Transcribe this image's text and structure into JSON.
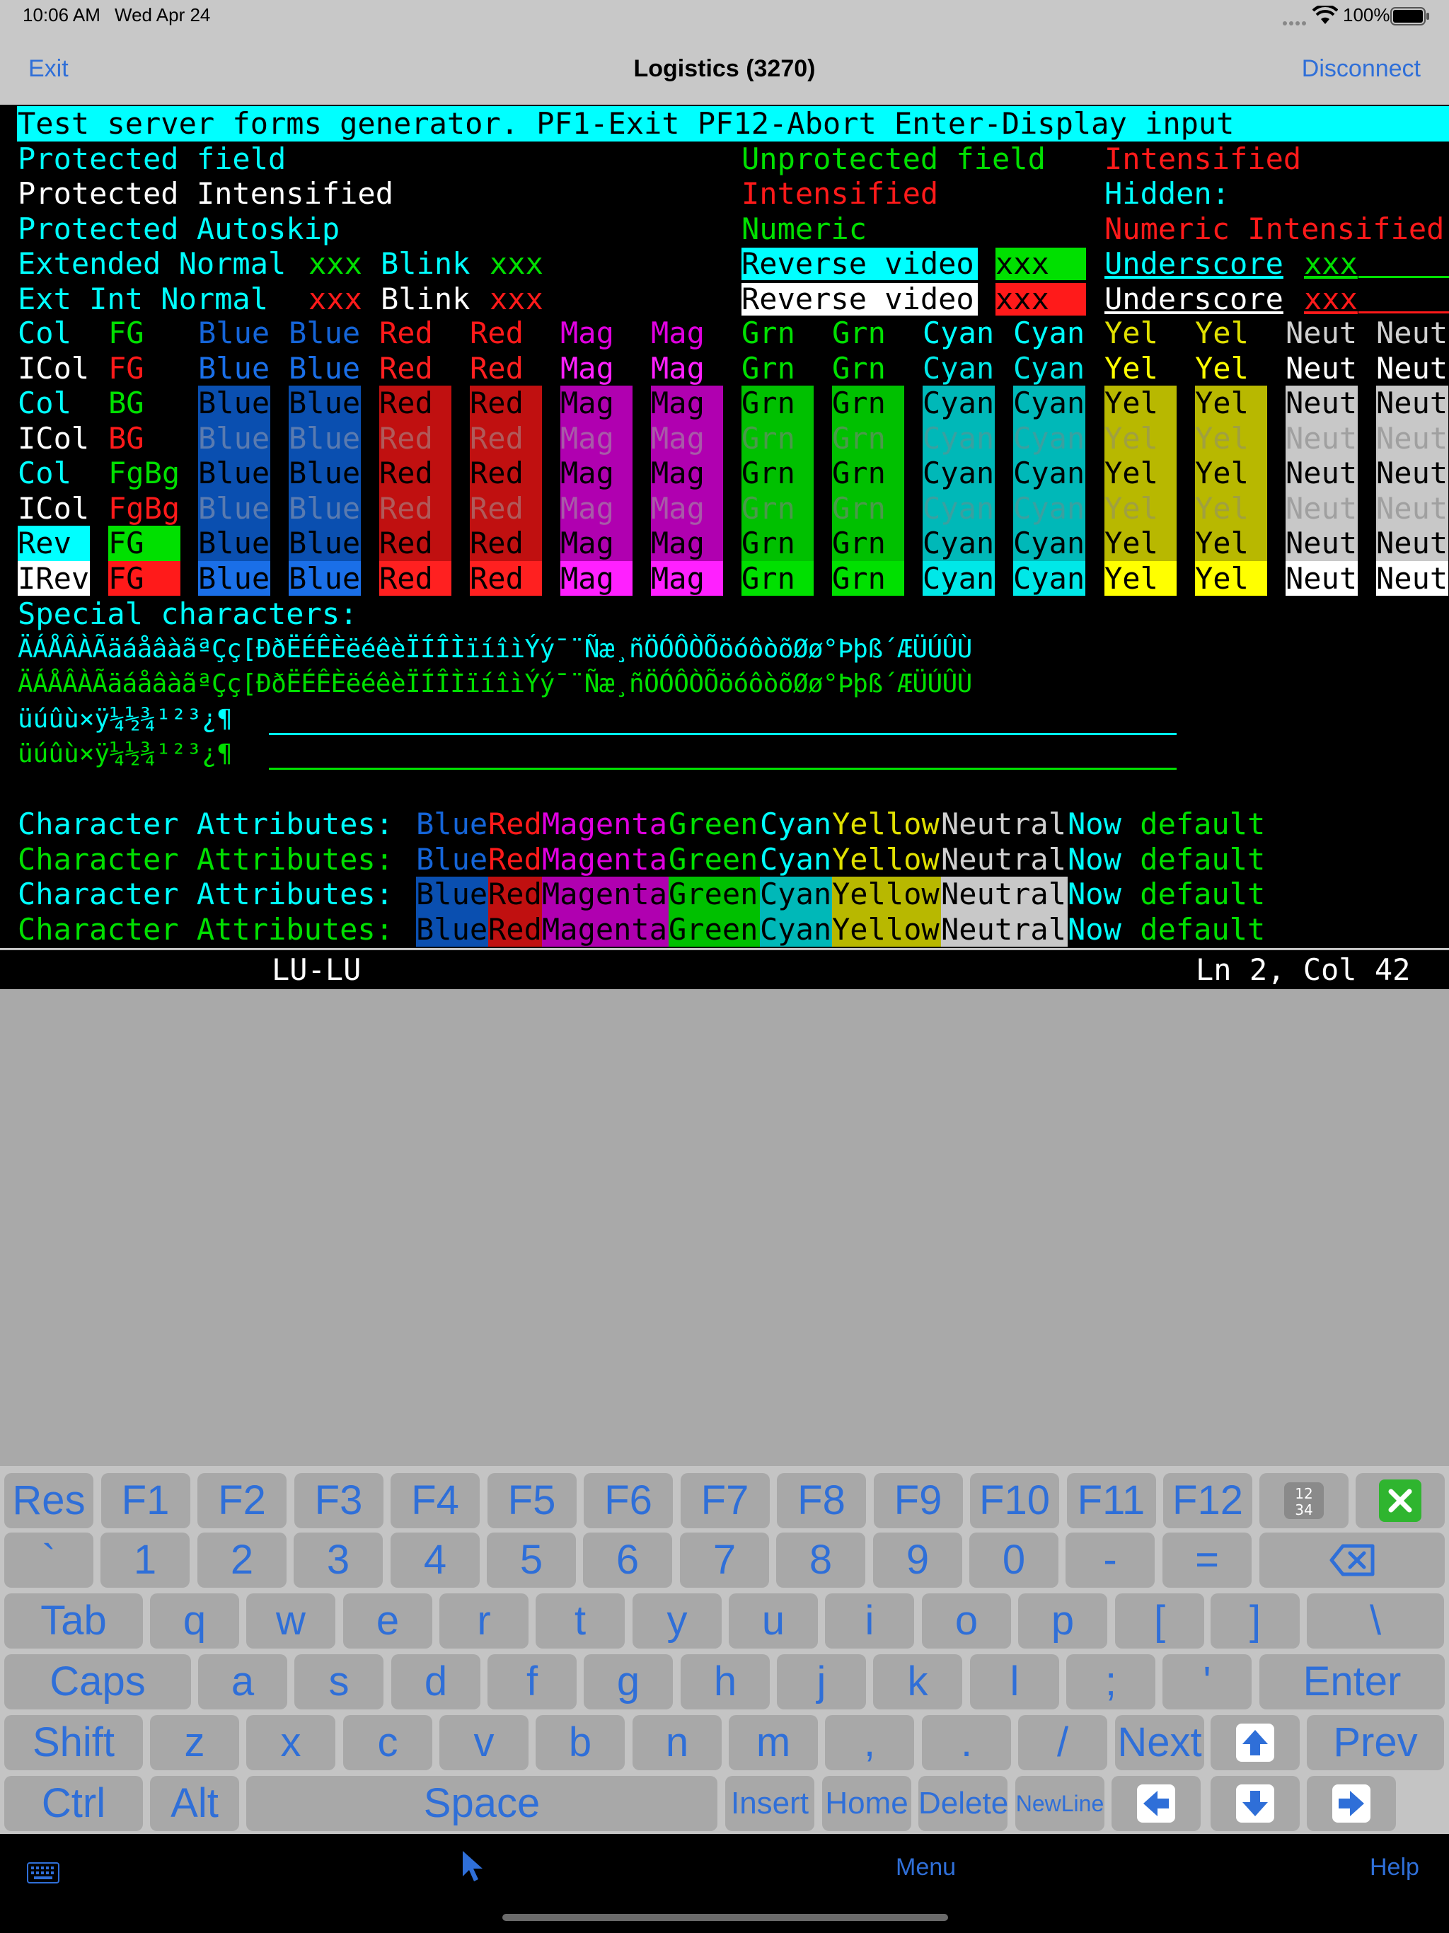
{
  "status_bar": {
    "time": "10:06 AM",
    "date": "Wed Apr 24",
    "battery": "100%"
  },
  "nav": {
    "exit_label": "Exit",
    "title": "Logistics (3270)",
    "disconnect_label": "Disconnect"
  },
  "colors": {
    "cyan": "#00ffff",
    "cyan_dim": "#00cccc",
    "green": "#00e000",
    "white": "#ffffff",
    "red": "#ff1a1a",
    "blue": "#1565d8",
    "magenta": "#e000e0",
    "yellow": "#e0e000",
    "neutral": "#d0d0d0",
    "link": "#2f6fd8"
  },
  "terminal": {
    "banner": "Test server forms generator. PF1-Exit PF12-Abort Enter-Display input",
    "fields": {
      "protected_field": "Protected field",
      "unprotected_field": "Unprotected field",
      "intensified": "Intensified",
      "protected_intensified": "Protected Intensified",
      "intensified_2": "Intensified",
      "hidden": "Hidden:",
      "protected_autoskip": "Protected Autoskip",
      "numeric": "Numeric",
      "numeric_intensified": "Numeric Intensified",
      "extended_normal": "Extended Normal",
      "ext_xxx1": "xxx",
      "blink": "Blink",
      "ext_xxx2": "xxx",
      "reverse_video": "Reverse video",
      "rev_xxx": "xxx",
      "underscore": "Underscore",
      "und_xxx": "xxx",
      "ext_int_normal": "Ext Int Normal",
      "int_xxx1": "xxx",
      "blink2": "Blink",
      "int_xxx2": "xxx",
      "reverse_video2": "Reverse video",
      "rev_xxx2": "xxx",
      "underscore2": "Underscore",
      "und_xxx2": "xxx"
    },
    "color_grid": {
      "row_labels": [
        "Col",
        "ICol",
        "Col",
        "ICol",
        "Col",
        "ICol",
        "Rev",
        "IRev"
      ],
      "mode_labels": [
        "FG",
        "FG",
        "BG",
        "BG",
        "FgBg",
        "FgBg",
        "FG",
        "FG"
      ],
      "cells": [
        "Blue",
        "Blue",
        "Red",
        "Red",
        "Mag",
        "Mag",
        "Grn",
        "Grn",
        "Cyan",
        "Cyan",
        "Yel",
        "Yel",
        "Neut",
        "Neut"
      ]
    },
    "special": {
      "title": "Special characters:",
      "line1": "ÄÁÅÂÀÃäáåâàãªÇç[ÐðËÉÊÈëéêèÏÍÎÌïíîìÝý¯¨Ñæ¸ñÖÓÔÒÕöóôòõØø°Þþß´ÆÜÚÛÙ",
      "line2": "ÄÁÅÂÀÃäáåâàãªÇç[ÐðËÉÊÈëéêèÏÍÎÌïíîìÝý¯¨Ñæ¸ñÖÓÔÒÕöóôòõØø°Þþß´ÆÜÚÛÙ",
      "line3": "üúûù×ÿ¼½¾¹²³¿¶",
      "line4": "üúûù×ÿ¼½¾¹²³¿¶"
    },
    "char_attrs": {
      "label": "Character Attributes: ",
      "words": [
        "Blue",
        "Red",
        "Magenta",
        "Green",
        "Cyan",
        "Yellow",
        "Neutral"
      ],
      "now": "Now",
      "default": " default"
    }
  },
  "info_bar": {
    "lu": "LU-LU",
    "cursor": "Ln 2, Col 42"
  },
  "keyboard": {
    "row1": [
      "Res",
      "F1",
      "F2",
      "F3",
      "F4",
      "F5",
      "F6",
      "F7",
      "F8",
      "F9",
      "F10",
      "F11",
      "F12"
    ],
    "row2": [
      "`",
      "1",
      "2",
      "3",
      "4",
      "5",
      "6",
      "7",
      "8",
      "9",
      "0",
      "-",
      "="
    ],
    "row3": [
      "Tab",
      "q",
      "w",
      "e",
      "r",
      "t",
      "y",
      "u",
      "i",
      "o",
      "p",
      "[",
      "]",
      "\\"
    ],
    "row4": [
      "Caps",
      "a",
      "s",
      "d",
      "f",
      "g",
      "h",
      "j",
      "k",
      "l",
      ";",
      "'",
      "Enter"
    ],
    "row5": [
      "Shift",
      "z",
      "x",
      "c",
      "v",
      "b",
      "n",
      "m",
      ",",
      ".",
      "/",
      "Next",
      "Prev"
    ],
    "row6": [
      "Ctrl",
      "Alt",
      "Space",
      "Insert",
      "Home",
      "Delete",
      "NewLine"
    ],
    "numpad_icon": "numpad-icon",
    "close_icon": "close-icon"
  },
  "bottom_bar": {
    "menu_label": "Menu",
    "help_label": "Help"
  }
}
